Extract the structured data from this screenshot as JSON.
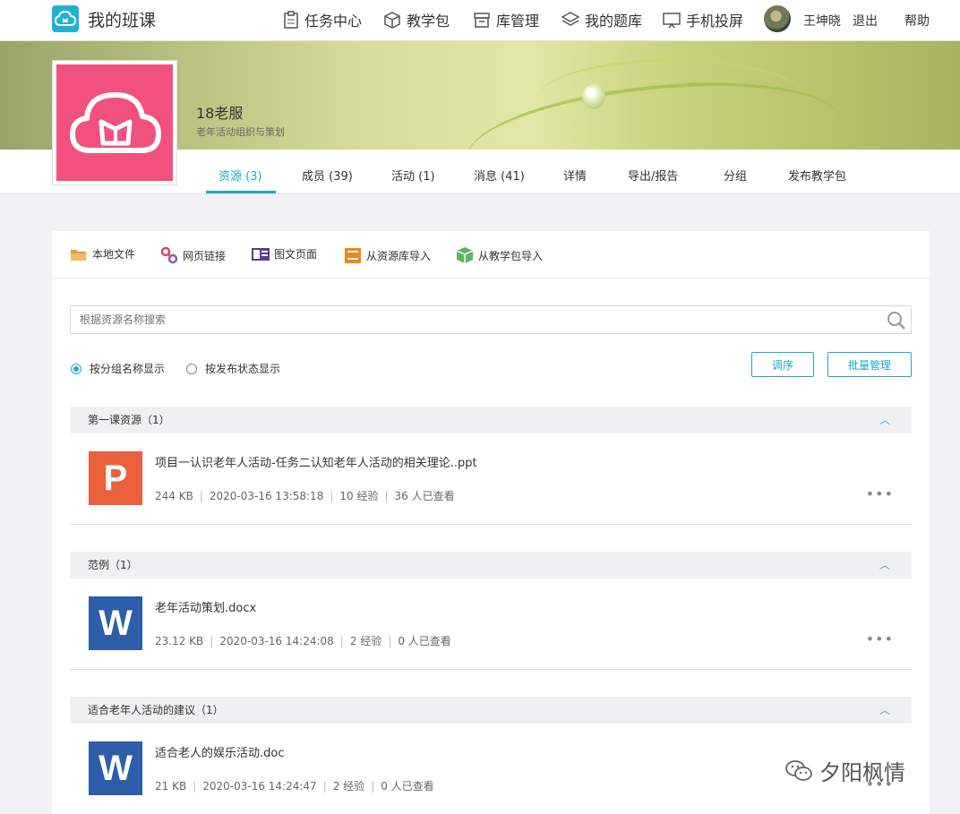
{
  "app": {
    "title": "我的班课"
  },
  "nav": {
    "tasks": "任务中心",
    "packages": "教学包",
    "library": "库管理",
    "questions": "我的题库",
    "mirror": "手机投屏",
    "user_name": "王坤晓",
    "logout": "退出",
    "help": "帮助"
  },
  "course": {
    "name": "18老服",
    "subtitle": "老年活动组织与策划"
  },
  "tabs": [
    {
      "label": "资源 (3)"
    },
    {
      "label": "成员 (39)"
    },
    {
      "label": "活动 (1)"
    },
    {
      "label": "消息 (41)"
    },
    {
      "label": "详情"
    },
    {
      "label": "导出/报告"
    },
    {
      "label": "分组"
    },
    {
      "label": "发布教学包"
    }
  ],
  "toolbar": {
    "local_file": "本地文件",
    "web_link": "网页链接",
    "rich_page": "图文页面",
    "from_library": "从资源库导入",
    "from_package": "从教学包导入"
  },
  "search": {
    "placeholder": "根据资源名称搜索"
  },
  "view": {
    "by_group": "按分组名称显示",
    "by_status": "按发布状态显示",
    "sort_button": "调序",
    "batch_button": "批量管理"
  },
  "groups": [
    {
      "title": "第一课资源（1）",
      "file": {
        "type": "P",
        "name": "项目一认识老年人活动-任务二认知老年人活动的相关理论..ppt",
        "size": "244 KB",
        "date": "2020-03-16 13:58:18",
        "exp": "10 经验",
        "views": "36 人已查看"
      }
    },
    {
      "title": "范例（1）",
      "file": {
        "type": "W",
        "name": "老年活动策划.docx",
        "size": "23.12 KB",
        "date": "2020-03-16 14:24:08",
        "exp": "2 经验",
        "views": "0 人已查看"
      }
    },
    {
      "title": "适合老年人活动的建议（1）",
      "file": {
        "type": "W",
        "name": "适合老人的娱乐活动.doc",
        "size": "21 KB",
        "date": "2020-03-16 14:24:47",
        "exp": "2 经验",
        "views": "0 人已查看"
      }
    }
  ],
  "watermark": "夕阳枫情",
  "colors": {
    "accent": "#1fa9c9",
    "cover": "#f1517f",
    "ppt": "#e8603c",
    "word": "#2e5da9"
  }
}
